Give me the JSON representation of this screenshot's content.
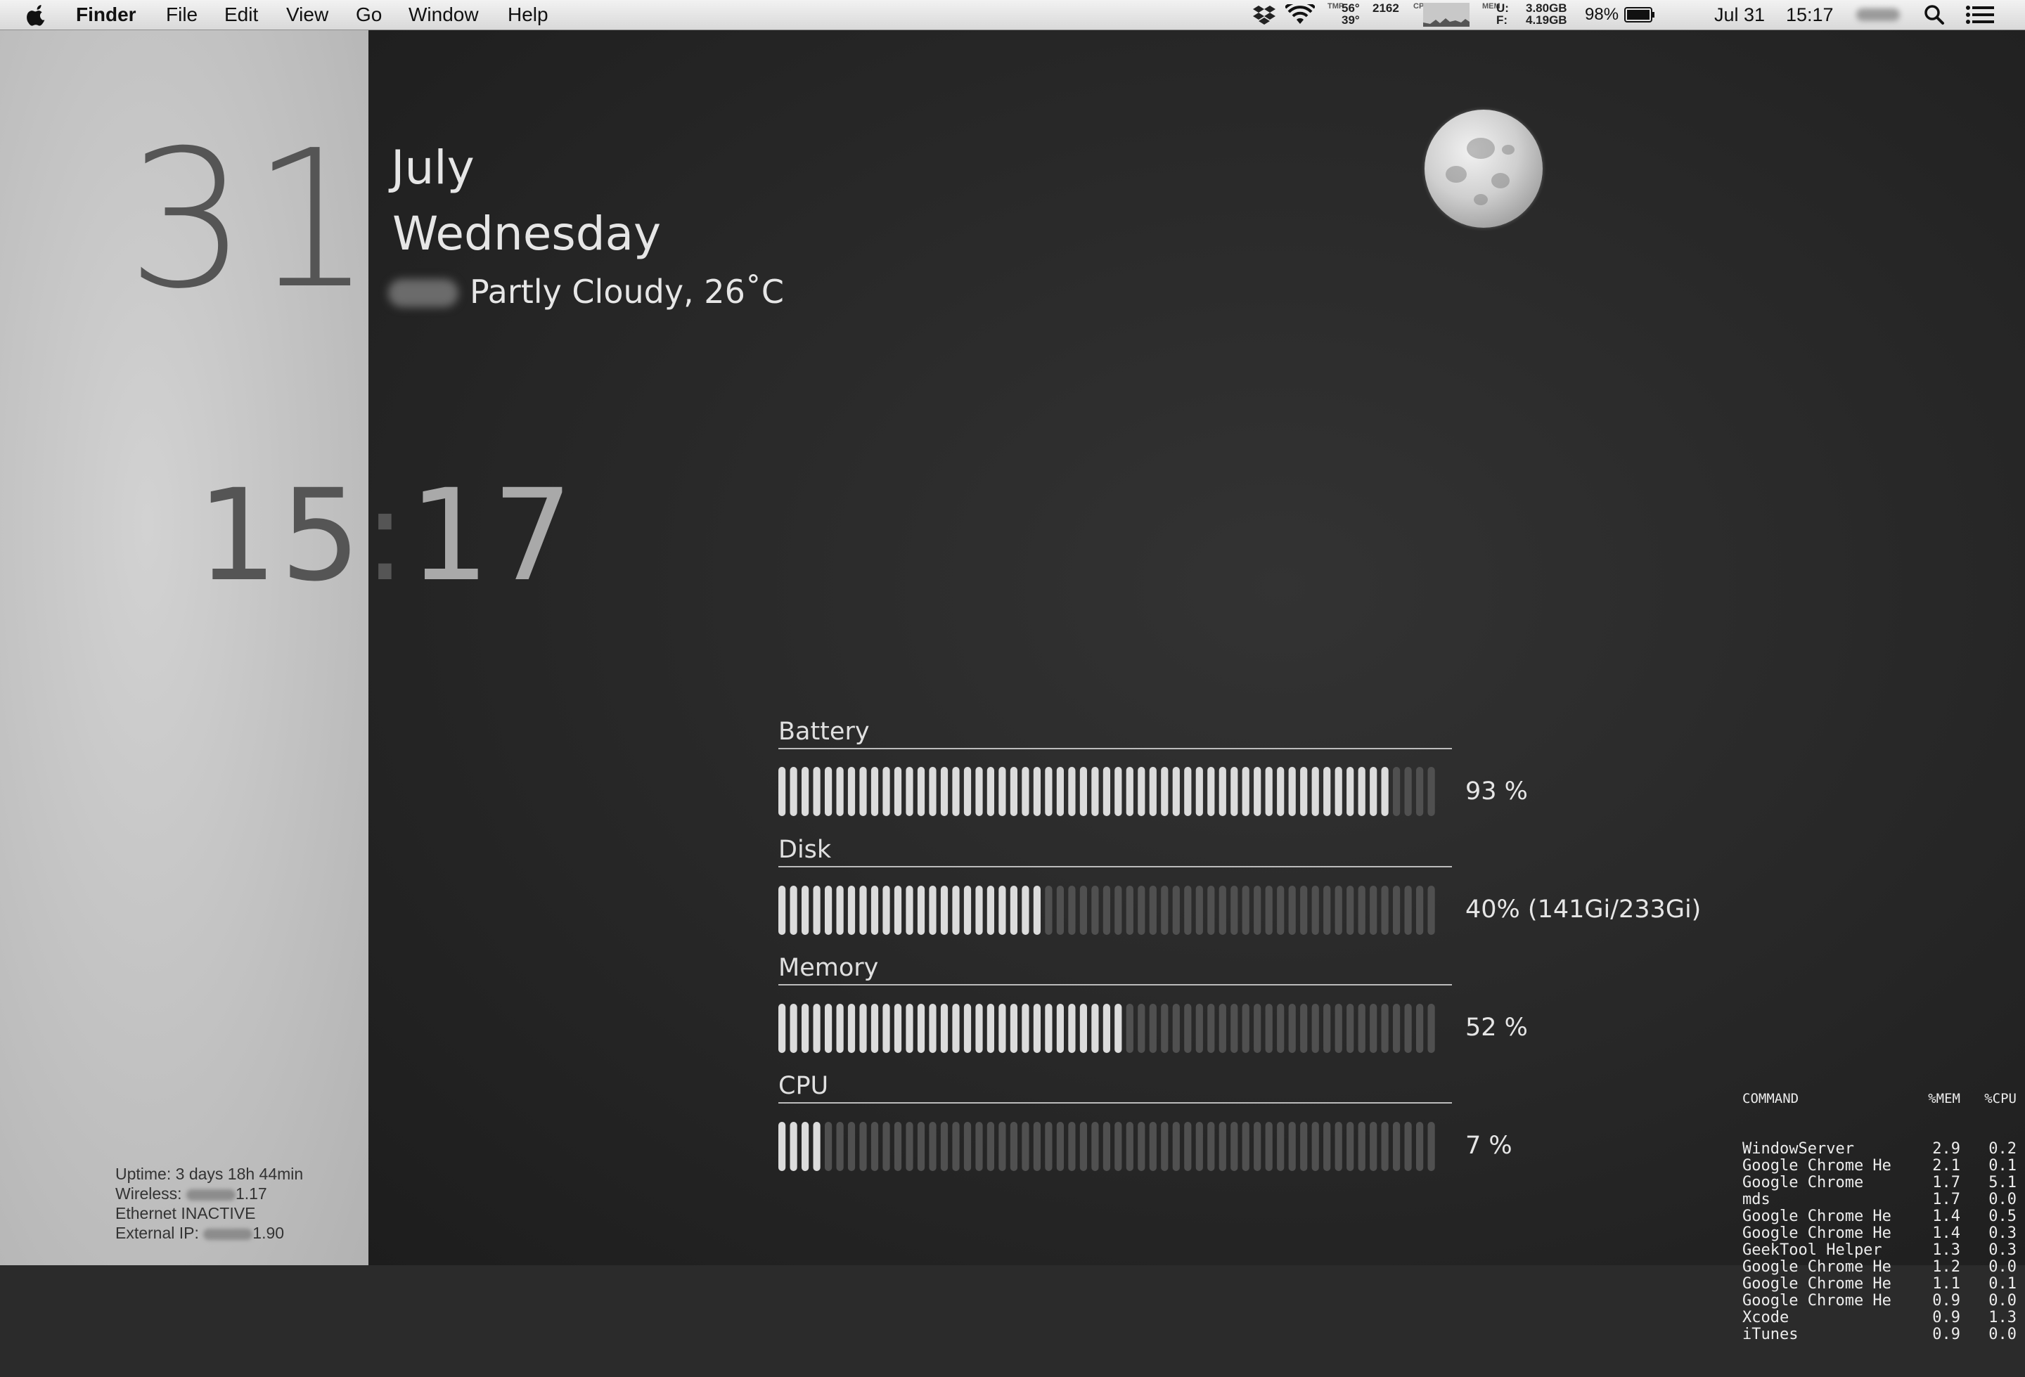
{
  "menubar": {
    "app_name": "Finder",
    "menus": [
      "File",
      "Edit",
      "View",
      "Go",
      "Window",
      "Help"
    ],
    "status": {
      "temp_1": "56°",
      "temp_2": "39°",
      "fan_rpm": "2162",
      "tmp_label": "TMP",
      "cpu_label": "CPU",
      "mem_label": "MEM",
      "mem_used_label": "U:",
      "mem_free_label": "F:",
      "mem_used": "3.80GB",
      "mem_free": "4.19GB",
      "battery_pct": "98%",
      "date": "Jul 31",
      "time": "15:17"
    }
  },
  "date_widget": {
    "day": "31",
    "month": "July",
    "weekday": "Wednesday",
    "weather": "Partly Cloudy, 26˚C"
  },
  "clock": {
    "hours": "15:",
    "minutes": "17"
  },
  "meters": [
    {
      "label": "Battery",
      "value_text": "93 %",
      "fraction": 0.93
    },
    {
      "label": "Disk",
      "value_text": "40% (141Gi/233Gi)",
      "fraction": 0.4
    },
    {
      "label": "Memory",
      "value_text": "52 %",
      "fraction": 0.52
    },
    {
      "label": "CPU",
      "value_text": "7 %",
      "fraction": 0.07
    }
  ],
  "processes": {
    "headers": [
      "COMMAND",
      "%MEM",
      "%CPU"
    ],
    "rows": [
      [
        "WindowServer",
        "2.9",
        "0.2"
      ],
      [
        "Google Chrome He",
        "2.1",
        "0.1"
      ],
      [
        "Google Chrome",
        "1.7",
        "5.1"
      ],
      [
        "mds",
        "1.7",
        "0.0"
      ],
      [
        "Google Chrome He",
        "1.4",
        "0.5"
      ],
      [
        "Google Chrome He",
        "1.4",
        "0.3"
      ],
      [
        "GeekTool Helper",
        "1.3",
        "0.3"
      ],
      [
        "Google Chrome He",
        "1.2",
        "0.0"
      ],
      [
        "Google Chrome He",
        "1.1",
        "0.1"
      ],
      [
        "Google Chrome He",
        "0.9",
        "0.0"
      ],
      [
        "Xcode",
        "0.9",
        "1.3"
      ],
      [
        "iTunes",
        "0.9",
        "0.0"
      ]
    ]
  },
  "network": {
    "uptime": "Uptime: 3 days 18h 44min",
    "wireless_label": "Wireless:",
    "wireless_suffix": "1.17",
    "ethernet": "Ethernet INACTIVE",
    "external_label": "External IP:",
    "external_suffix": "1.90"
  },
  "icons": [
    "apple-logo-icon",
    "dropbox-icon",
    "wifi-icon",
    "battery-icon",
    "spotlight-search-icon",
    "notification-center-icon",
    "moon-icon"
  ]
}
